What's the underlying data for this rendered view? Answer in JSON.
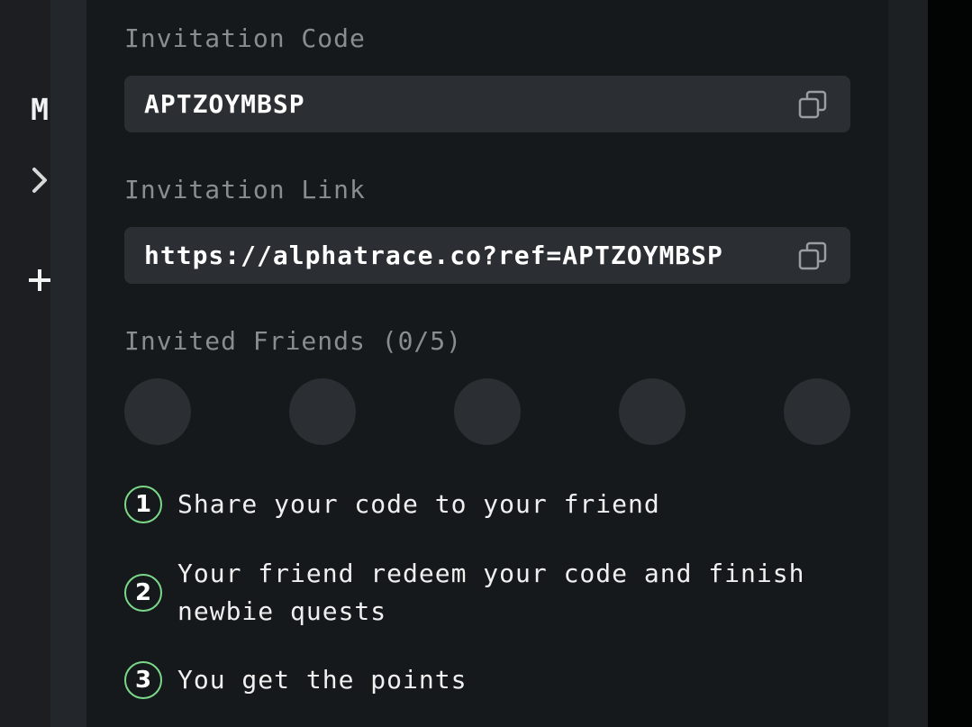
{
  "sidebar": {
    "letter": "M",
    "chevron_icon": "chevron-right-icon",
    "add_icon": "plus-icon"
  },
  "invitation": {
    "code_label": "Invitation Code",
    "code_value": "APTZOYMBSP",
    "link_label": "Invitation Link",
    "link_value": "https://alphatrace.co?ref=APTZOYMBSP",
    "copy_icon": "copy-icon"
  },
  "friends": {
    "label": "Invited Friends (0/5)",
    "slots": 5
  },
  "steps": [
    {
      "number": "1",
      "text": "Share your code to your friend"
    },
    {
      "number": "2",
      "text": "Your friend redeem your code and finish newbie quests"
    },
    {
      "number": "3",
      "text": "You get the points"
    }
  ],
  "colors": {
    "panel_bg": "#16191b",
    "field_bg": "#2b2e32",
    "accent_green": "#7bd88a",
    "muted_text": "#8a8d90"
  }
}
